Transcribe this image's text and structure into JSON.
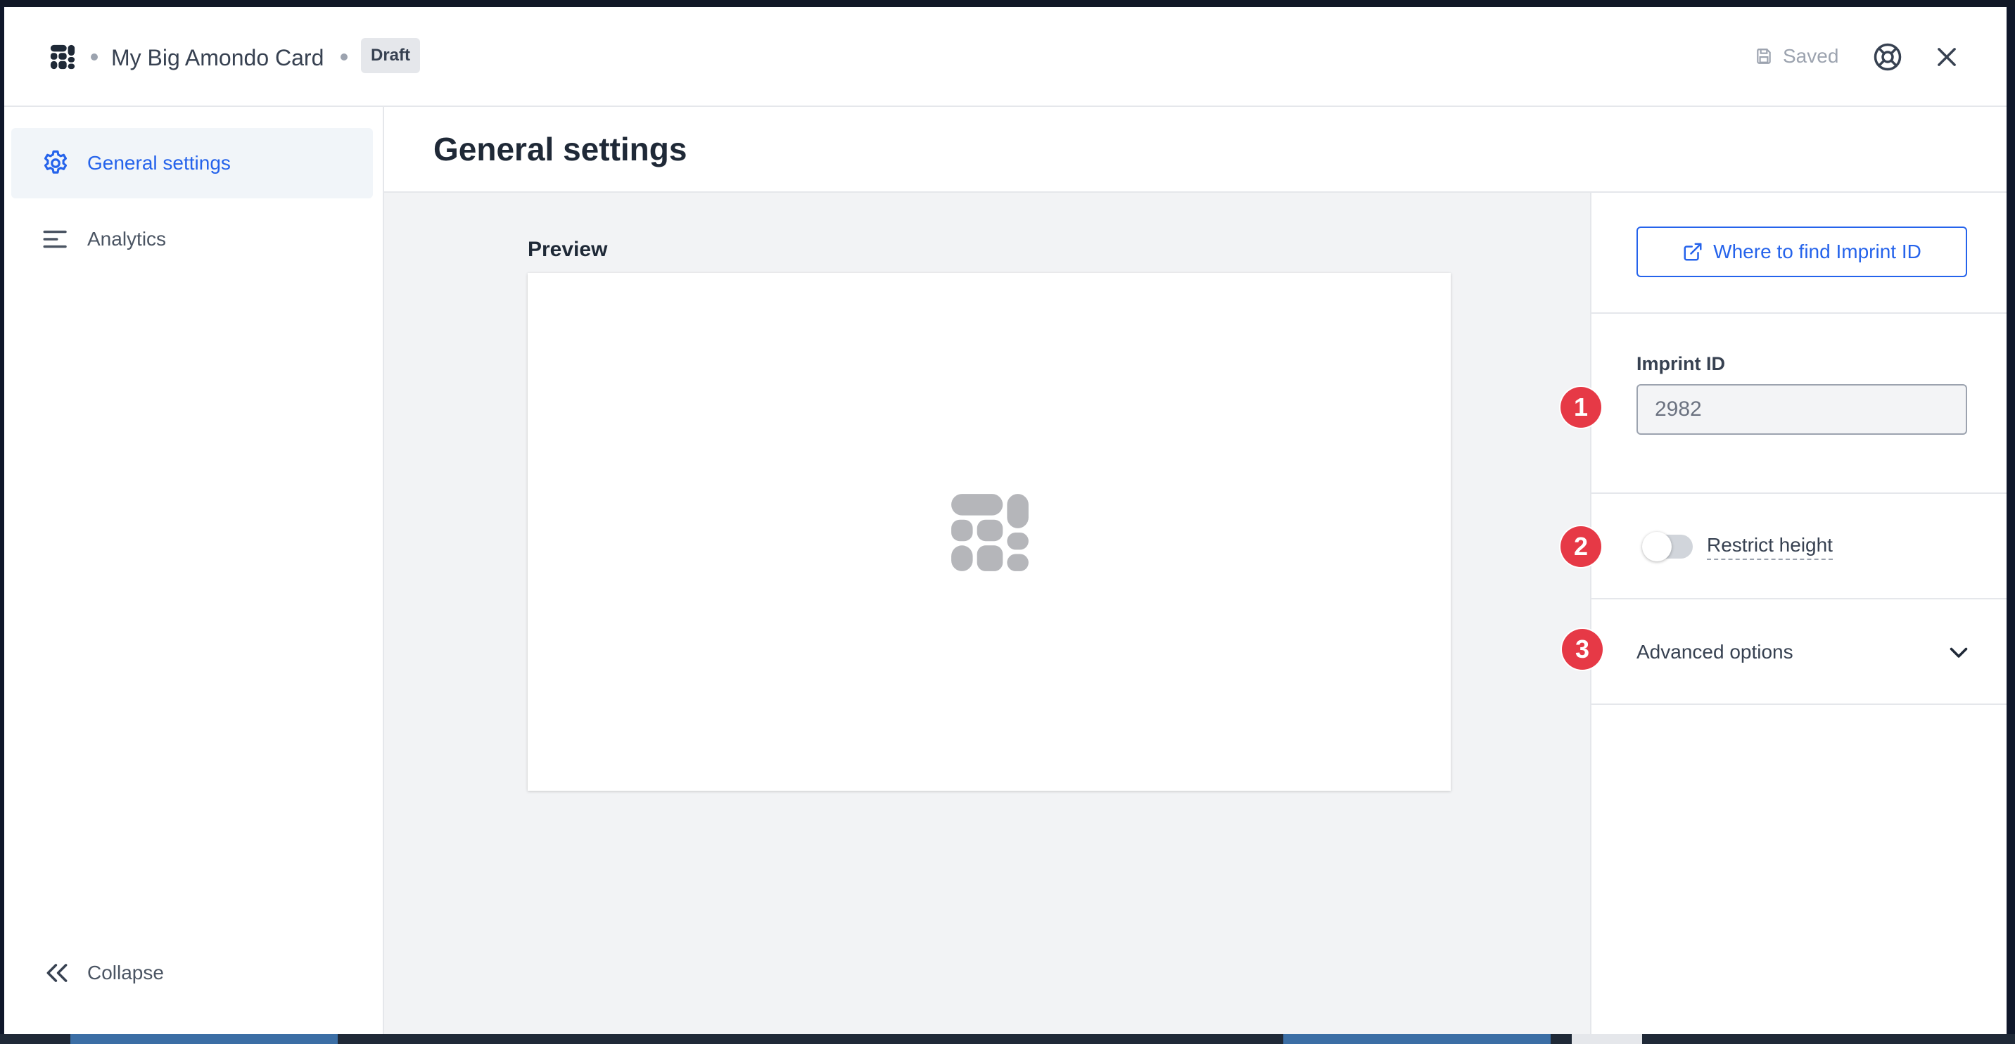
{
  "header": {
    "title": "My Big Amondo Card",
    "status_badge": "Draft",
    "saved_label": "Saved"
  },
  "sidebar": {
    "items": [
      {
        "label": "General settings",
        "icon": "gear-icon",
        "active": true
      },
      {
        "label": "Analytics",
        "icon": "bars-left-icon",
        "active": false
      }
    ],
    "collapse_label": "Collapse"
  },
  "main": {
    "page_title": "General settings",
    "preview_label": "Preview"
  },
  "panel": {
    "imprint_link_label": "Where to find Imprint ID",
    "imprint_field_label": "Imprint ID",
    "imprint_value": "2982",
    "restrict_height_label": "Restrict height",
    "restrict_height_on": false,
    "advanced_label": "Advanced options"
  },
  "steps": [
    "1",
    "2",
    "3"
  ],
  "colors": {
    "accent": "#2563eb",
    "step_badge": "#e63946",
    "content_bg": "#f2f3f5",
    "active_nav_bg": "#f1f5f9"
  }
}
